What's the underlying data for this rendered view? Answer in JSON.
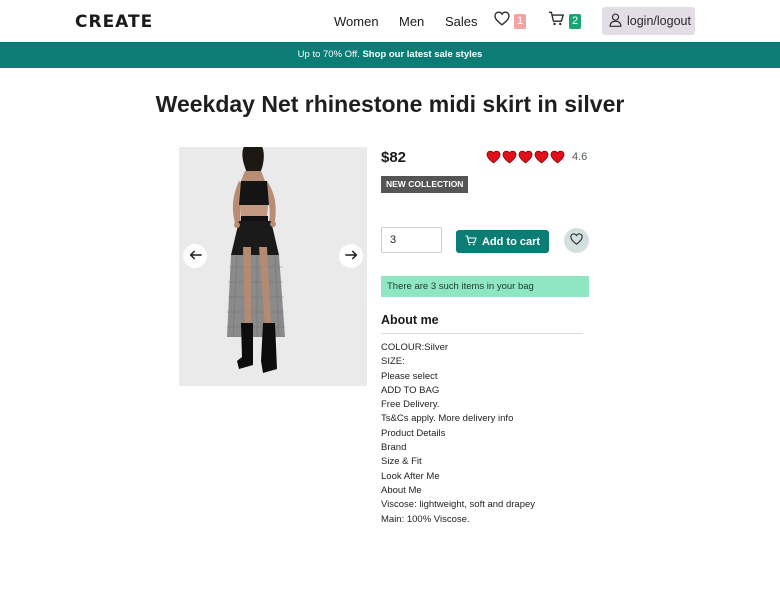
{
  "header": {
    "logo": "CREATE",
    "nav": [
      "Women",
      "Men",
      "Sales"
    ],
    "wishlist_count": "1",
    "cart_count": "2",
    "login_label": "login/logout"
  },
  "promo": {
    "text": "Up to 70% Off.",
    "link": "Shop our latest sale styles"
  },
  "product": {
    "title": "Weekday Net rhinestone midi skirt in silver",
    "price": "$82",
    "rating": "4.6",
    "rating_hearts": 5,
    "tag": "NEW COLLECTION",
    "quantity": "3",
    "add_to_cart_label": "Add to cart",
    "bag_notice": "There are 3 such items in your bag",
    "about_heading": "About me",
    "about_lines": [
      "COLOUR:Silver",
      "SIZE:",
      "Please select",
      "ADD TO BAG",
      "Free Delivery.",
      "Ts&Cs apply. More delivery info",
      "Product Details",
      "Brand",
      "Size & Fit",
      "Look After Me",
      "About Me",
      "Viscose: lightweight, soft and drapey",
      "Main: 100% Viscose."
    ]
  },
  "colors": {
    "brand_teal": "#0c7d74",
    "notice_green": "#8ee7c2",
    "wishlist_badge": "#f4a3a3",
    "cart_badge": "#17a673",
    "heart_red": "#e0101a"
  },
  "icons": [
    "heart-icon",
    "cart-icon",
    "user-icon",
    "arrow-left-icon",
    "arrow-right-icon"
  ]
}
